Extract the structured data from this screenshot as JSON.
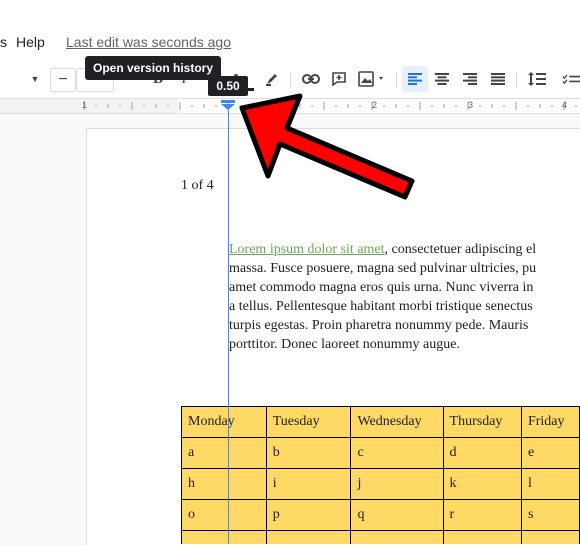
{
  "menubar": {
    "edge_label": "s",
    "help_label": "Help",
    "last_edit": "Last edit was seconds ago"
  },
  "tooltip": {
    "text": "Open version history"
  },
  "toolbar": {
    "minus_label": "−",
    "bold_label": "B",
    "italic_label": "I",
    "textcolor_label": "A",
    "active_color": "#e8f0fe"
  },
  "ruler": {
    "badge": "0.50",
    "numbers": [
      "1",
      "1",
      "2",
      "3",
      "4"
    ],
    "marker_color": "#4285f4"
  },
  "document": {
    "page_count": "1 of 4",
    "paragraph": {
      "link_text": "Lorem ipsum dolor sit amet",
      "line1_rest": ", consectetuer adipiscing el",
      "line2": "massa. Fusce posuere, magna sed pulvinar ultricies, pu",
      "line3": "amet commodo magna eros quis urna. Nunc viverra in",
      "line4": "a tellus. Pellentesque habitant morbi tristique senectus",
      "line5": "turpis egestas. Proin pharetra nonummy pede. Mauris",
      "line6": "porttitor. Donec laoreet nonummy augue."
    },
    "table": {
      "headers": [
        "Monday",
        "Tuesday",
        "Wednesday",
        "Thursday",
        "Friday"
      ],
      "rows": [
        [
          "a",
          "b",
          "c",
          "d",
          "e"
        ],
        [
          "h",
          "i",
          "j",
          "k",
          "l"
        ],
        [
          "o",
          "p",
          "q",
          "r",
          "s"
        ]
      ],
      "fill_color": "#ffd966"
    }
  },
  "annotation": {
    "arrow_color": "#ff0000"
  }
}
